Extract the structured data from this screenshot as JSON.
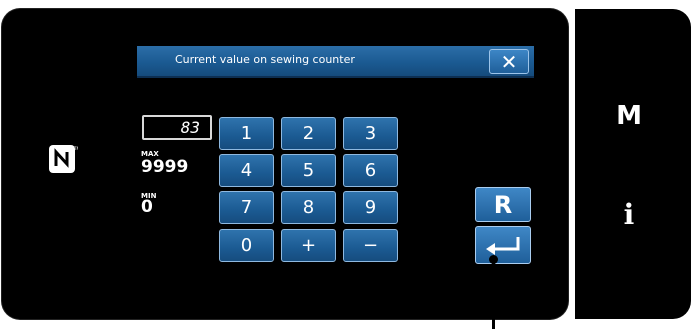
{
  "dialog": {
    "title": "Current value on sewing counter",
    "close_label": "✕"
  },
  "display": {
    "current_value": "83"
  },
  "limits": {
    "max_label": "MAX",
    "max_value": "9999",
    "min_label": "MIN",
    "min_value": "0"
  },
  "keypad": {
    "k1": "1",
    "k2": "2",
    "k3": "3",
    "k4": "4",
    "k5": "5",
    "k6": "6",
    "k7": "7",
    "k8": "8",
    "k9": "9",
    "k0": "0",
    "plus": "+",
    "minus": "−"
  },
  "buttons": {
    "reset_label": "R",
    "enter_icon": "enter-icon"
  },
  "side_panel": {
    "m_label": "M",
    "i_label": "i"
  },
  "colors": {
    "key_blue": "#1b5a92",
    "key_border": "#8fb9e0",
    "background": "#000000"
  }
}
